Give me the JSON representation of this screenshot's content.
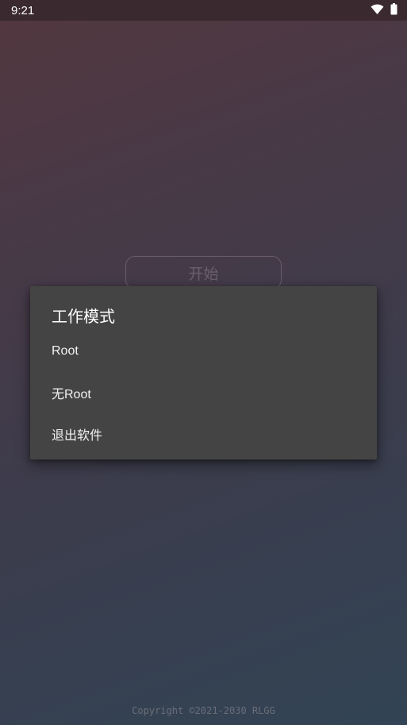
{
  "status_bar": {
    "time": "9:21",
    "icons": [
      "wifi-icon",
      "battery-icon"
    ]
  },
  "main": {
    "start_button_label": "开始"
  },
  "dialog": {
    "title": "工作模式",
    "items": [
      {
        "label": "Root"
      },
      {
        "label": "无Root"
      },
      {
        "label": "退出软件"
      }
    ]
  },
  "footer": {
    "copyright": "Copyright ©2021-2030 RLGG"
  },
  "colors": {
    "dialog_bg": "#444444",
    "status_bar_bg": "#3a2a30"
  }
}
